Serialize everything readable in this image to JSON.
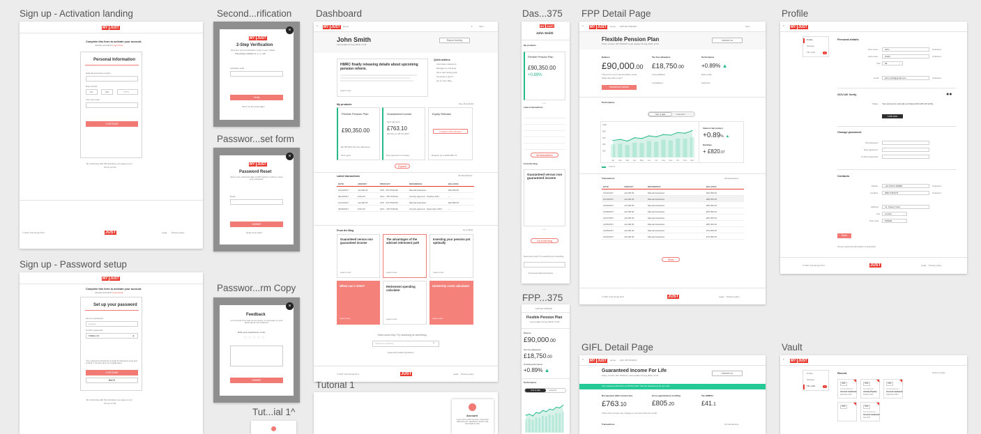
{
  "labels": {
    "activation": "Sign up - Activation landing",
    "second": "Second...rification",
    "dashboard": "Dashboard",
    "das375": "Das...375",
    "fpp": "FPP Detail Page",
    "profile": "Profile",
    "pw_reset_form": "Passwor...set form",
    "pw_setup": "Sign up - Password setup",
    "pw_copy": "Passwor...rm Copy",
    "fpp375": "FPP...375",
    "gifl": "GIFL Detail Page",
    "vault": "Vault",
    "tutorial": "Tutorial 1",
    "tutorial_small": "Tut...ial 1^"
  },
  "brand": {
    "pre": "MY",
    "name": "JUST",
    "dot": "."
  },
  "activation": {
    "intro": "Complete this form to activate your account.",
    "already": "Already activated?",
    "login": "Log in here",
    "heading": "Personal Information",
    "f1": "National insurance number",
    "f2": "Date of birth",
    "dd": "DD",
    "mm": "MM",
    "yyyy": "YYYY",
    "f3": "Your post code",
    "btn": "CONTINUE",
    "terms_pre": "By continuing with this activation you agree to our",
    "terms": "Terms of Use",
    "footer_copy": "© 2017 Just Group PLC",
    "legal": "Legal",
    "privacy": "Privacy policy"
  },
  "second": {
    "title": "2-Step Verification",
    "desc": "We have sent an activation code to your mobile.",
    "phone": "The phone number is ••• ••• •34",
    "label": "Activation code",
    "btn": "Verify",
    "resend": "Send me the code again"
  },
  "reset": {
    "title": "Password Reset",
    "desc": "Enter your email and date of birth below in order to reset your password.",
    "email": "Email",
    "btn": "SUBMIT",
    "link": "Need some help?"
  },
  "feedback": {
    "title": "Feedback",
    "desc": "Let us know how well we are doing, or just leave us your ideas about new features!",
    "rate": "Rate your experience so far",
    "btn": "SUBMIT"
  },
  "setup": {
    "intro": "Complete this form to activate your account.",
    "already": "Already activated?",
    "login": "Log in here",
    "heading": "Set up your password",
    "f1": "Set up a password",
    "f2": "Confirm password",
    "pw_mask": "••••••••••",
    "pw_plain": "Pa$$word1",
    "help": "Your password should be at least 8 characters long and include 1 number and one capital letter.",
    "btn": "CONTINUE",
    "back": "BACK",
    "terms_pre": "By continuing with this activation you agree to our",
    "terms": "Terms of Use"
  },
  "dash": {
    "nav_home": "Home",
    "user_short": "John",
    "name": "John Smith",
    "last_login": "Last update 23 Aug 2018, 11:34",
    "report_btn": "Report Activity",
    "news_title": "HMRC finally releasing details about upcoming pension reform.",
    "news_link": "Learn more",
    "quick_title": "Quick actions",
    "quick": [
      "View latest statement",
      "Manage my risk level",
      "Set a new saving goal",
      "Generate a report",
      "Go to more Blog"
    ],
    "products_title": "My products",
    "see_all": "See all products",
    "p1": "Flexible Pension Plan",
    "p1_val": "£90,350.00",
    "p1_foot": "£8,750.00% Tax free allowance",
    "p1_link": "All is good",
    "p2": "Guaranteed Income",
    "p2_label": "Next payment",
    "p2_val": "£763.10",
    "p2_sub": "Pension on 28 Oct 2017",
    "p2_link": "Next payment in 14 days",
    "p3": "Equity Release",
    "p3_btn": "Enquire with adviser",
    "p3_foot": "Release up to £300,000.73",
    "expand": "Expand",
    "tx_title": "Latest transactions",
    "tx_all": "All transactions",
    "tx_head": [
      "DATE",
      "AMOUNT",
      "PRODUCT",
      "REFERENCE",
      "BALANCE"
    ],
    "tx": [
      [
        "12/12/2017",
        "-£2,000.00",
        "FPP - 397 PFRA35",
        "Manual drawdown",
        "£90,350.00"
      ],
      [
        "28/10/2017",
        "£763.10",
        "GIFL - 397 PFR412",
        "Annuity payment - October 2017",
        "—"
      ],
      [
        "12/12/2017",
        "-£2,000.00",
        "FPP - 397 PFRA35",
        "Manual drawdown",
        "£92,350.00"
      ],
      [
        "29/09/2017",
        "£763.10",
        "GIFL - 397 PFR412",
        "Annuity payment - September 2017",
        "—"
      ]
    ],
    "blog_title": "From the Blog",
    "blog_all": "Go to Blog",
    "b1": "Guaranteed versus non guaranteed income",
    "b2": "The advantages of the advised retirement path",
    "b3": "Investing your pension pot optimally",
    "b4": "When can I retire?",
    "b5": "Retirement spending calculator",
    "b6": "University costs calculator",
    "learn": "Learn more",
    "help": "Need some help? Try searching for something...",
    "search_ph": "Search for anything",
    "faq": "Frequently Asked Questions",
    "footer_copy": "© 2017 Just Group PLC",
    "legal": "Legal",
    "privacy": "Privacy policy"
  },
  "mobile": {
    "name": "John Smith",
    "products": "My products",
    "p1": "Flexible Pension Plan",
    "val": "£90,350.00",
    "perf": "+0.89%",
    "tx": "Latest transactions",
    "blog": "From the blog",
    "b1": "Guaranteed versus non guaranteed income",
    "help": "Need some help? Try searching for something...",
    "faq": "Frequently Asked Questions",
    "all_tx": "All transactions",
    "go_blog": "Go to the blog"
  },
  "fpp": {
    "plan_ref": "FPP 397 PFRA35",
    "title": "Flexible Pension Plan",
    "policy": "Policy number 397 PFRA35 | Last update 23 Aug 2018, 11:34",
    "contact_btn": "Instruct us",
    "bal_label": "Balance",
    "bal": "£90,000",
    "bal_dec": ".00",
    "bal_note": "This pot is now in decumulation mode.",
    "bal_link": "What does this mean?",
    "bal_btn": "Investment advice",
    "tfa_label": "Tax free allowance",
    "tfa": "£18,750",
    "tfa_dec": ".00",
    "uncrys": "Uncrystallised",
    "crys": "Crystallised",
    "perf_label": "Performance",
    "perf": "+0.89%",
    "risk": "Risk profile",
    "gain": "Gain/loss",
    "chart_title": "Performance",
    "toggle_a": "Year to date",
    "toggle_b": "Long term",
    "int_rate": "Interest rate (comp.)",
    "int_val": "+0.89",
    "earnings": "Earnings",
    "earn_val": "+ £820",
    "earn_dec": ".07",
    "legend": "Fund 1",
    "tx_title": "Transactions",
    "tx_all": "All transactions",
    "tx_head": [
      "DATE",
      "AMOUNT",
      "REFERENCE",
      "BALANCE"
    ],
    "tx": [
      [
        "12/11/2017",
        "-£2,000.00",
        "Manual drawdown",
        "£90,350.00"
      ],
      [
        "12/10/2017",
        "-£2,000.00",
        "Manual drawdown",
        "£88,350.00"
      ],
      [
        "12/09/2017",
        "-£1,000.00",
        "Manual drawdown",
        "£86,350.00"
      ],
      [
        "12/08/2017",
        "-£2,000.00",
        "Manual drawdown",
        "£84,350.00"
      ],
      [
        "12/07/2017",
        "-£2,000.00",
        "Manual drawdown",
        "£82,350.00"
      ],
      [
        "12/06/2017",
        "-£2,000.00",
        "Manual drawdown",
        "£80,350.00"
      ],
      [
        "12/05/2017",
        "-£2,000.00",
        "Manual drawdown",
        "£78,350.00"
      ],
      [
        "12/04/2017",
        "-£2,000.00",
        "Manual drawdown",
        "£76,350.00"
      ]
    ],
    "more": "Show",
    "footer_copy": "© 2017 Just Group PLC",
    "legal": "Legal",
    "privacy": "Privacy policy"
  },
  "fpp375": {
    "ref": "FPP 397 PFRA35",
    "title": "Flexible Pension Plan",
    "sub": "Last update 23 Aug 2018, 11:34",
    "bal_label": "Balance",
    "bal": "£90,000",
    "bal_dec": ".00",
    "tfa_label": "Tax free allowance",
    "tfa": "£18,750",
    "tfa_dec": ".00",
    "perf_label": "Overall performance",
    "perf": "+0.89%",
    "chart": "Performance",
    "toggle_a": "Year to date",
    "toggle_b": "Long term"
  },
  "gifl": {
    "ref": "GIFL 397 PFR412",
    "title": "Guaranteed Income For Life",
    "policy": "Policy number 397 PFR412 | Last update 23 Aug 2018, 11:34",
    "btn": "Instruct us",
    "banner": "Your payment will arrive on 28 Nov 2017. We are preparing it for you now.",
    "l1": "Net payment (after income tax)",
    "v1": "£763",
    "v1d": ".10",
    "l2": "Gross (guaranteed, monthly)",
    "v2": "£805",
    "v2d": ".20",
    "l3": "Tax (HMRC)",
    "v3": "£41",
    "v3d": ".1",
    "note": "There has not been any change to your tax code this month.",
    "tx": "Transactions",
    "tx_all": "All transactions"
  },
  "profile": {
    "nav": [
      "Profile",
      "Settings",
      "File vault"
    ],
    "badge": "2",
    "personal": "Personal details",
    "first_l": "First name",
    "first": "John",
    "last_l": "Last name",
    "last": "Smith",
    "title_l": "Title",
    "title": "Mr.",
    "email_l": "email",
    "email": "john.smith@gmail.com",
    "updated": "Unlocked",
    "gov": "GOV.UK Verify",
    "gov_l": "Status",
    "gov_t": "Your account is currently not linked with GOV.UK Verify.",
    "gov_btn": "Link now",
    "cp": "Change password",
    "cp1": "Old password",
    "cp2": "New password",
    "cp3": "Confirm password",
    "contacts": "Contacts",
    "mobile_l": "Mobile",
    "mobile": "+44 07473 333865",
    "landline_l": "Landline",
    "landline": "0687 6457273",
    "address_l": "Address",
    "address": "12, Flower Court",
    "city_l": "City",
    "city": "London",
    "post_l": "Post code",
    "post": "SW10E",
    "save": "Save",
    "note": "All your personal information is protected.",
    "footer_copy": "© 2017 Just Group PLC",
    "legal": "Legal",
    "privacy": "Privacy policy"
  },
  "vault": {
    "nav": [
      "Profile",
      "Settings",
      "File vault"
    ],
    "badge": "2",
    "recent": "Recent",
    "sort": "Order by date",
    "docs": [
      {
        "tag": "PDF",
        "kind": "Annual statement",
        "title": "Account statement",
        "date": "November 2017"
      },
      {
        "tag": "PDF",
        "kind": "Tax statement",
        "title": "Annuity Payslip",
        "date": "October 2017"
      },
      {
        "tag": "PDF",
        "kind": "Annual statement",
        "title": "Account statement",
        "date": "September 2017"
      },
      {
        "tag": "PDF",
        "kind": "",
        "title": "",
        "date": ""
      },
      {
        "tag": "PDF",
        "kind": "Annual statement",
        "title": "Account statement",
        "date": "July 2017"
      }
    ]
  },
  "tutorial": {
    "title": "Account",
    "desc": "Lorem ipsum dolor sit amet, consectetur adipiscing elit. Vestibulum ultrices nulla, fells dapibus vitae."
  },
  "chart_data": {
    "type": "area",
    "x": [
      "Jan",
      "Feb",
      "Mar",
      "Apr",
      "May",
      "Jun",
      "Jul",
      "Aug",
      "Sep",
      "Oct",
      "Nov",
      "Dec"
    ],
    "values": [
      52,
      55,
      50,
      60,
      58,
      66,
      63,
      70,
      68,
      76,
      74,
      82
    ],
    "bars": [
      40,
      42,
      38,
      45,
      44,
      50,
      48,
      54,
      52,
      58,
      57,
      62
    ],
    "yticks": [
      "20K",
      "40K",
      "60K",
      "80K",
      "100K"
    ],
    "color": "#25b98a"
  },
  "colors": {
    "accent": "#e8372c",
    "coral": "#f27a74",
    "green": "#25b98a"
  }
}
